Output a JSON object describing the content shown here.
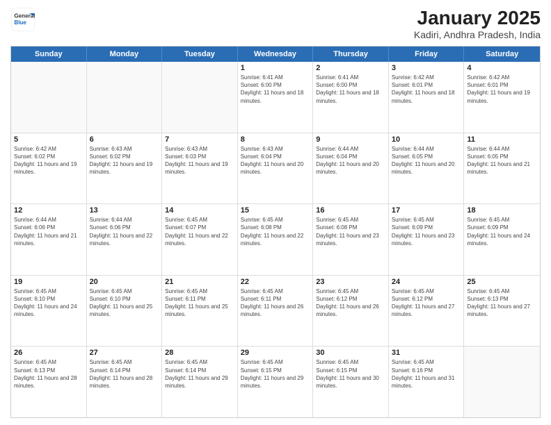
{
  "header": {
    "title": "January 2025",
    "subtitle": "Kadiri, Andhra Pradesh, India",
    "logo_general": "General",
    "logo_blue": "Blue"
  },
  "days_of_week": [
    "Sunday",
    "Monday",
    "Tuesday",
    "Wednesday",
    "Thursday",
    "Friday",
    "Saturday"
  ],
  "weeks": [
    [
      {
        "day": "",
        "empty": true
      },
      {
        "day": "",
        "empty": true
      },
      {
        "day": "",
        "empty": true
      },
      {
        "day": "1",
        "sunrise": "6:41 AM",
        "sunset": "6:00 PM",
        "daylight": "11 hours and 18 minutes."
      },
      {
        "day": "2",
        "sunrise": "6:41 AM",
        "sunset": "6:00 PM",
        "daylight": "11 hours and 18 minutes."
      },
      {
        "day": "3",
        "sunrise": "6:42 AM",
        "sunset": "6:01 PM",
        "daylight": "11 hours and 18 minutes."
      },
      {
        "day": "4",
        "sunrise": "6:42 AM",
        "sunset": "6:01 PM",
        "daylight": "11 hours and 19 minutes."
      }
    ],
    [
      {
        "day": "5",
        "sunrise": "6:42 AM",
        "sunset": "6:02 PM",
        "daylight": "11 hours and 19 minutes."
      },
      {
        "day": "6",
        "sunrise": "6:43 AM",
        "sunset": "6:02 PM",
        "daylight": "11 hours and 19 minutes."
      },
      {
        "day": "7",
        "sunrise": "6:43 AM",
        "sunset": "6:03 PM",
        "daylight": "11 hours and 19 minutes."
      },
      {
        "day": "8",
        "sunrise": "6:43 AM",
        "sunset": "6:04 PM",
        "daylight": "11 hours and 20 minutes."
      },
      {
        "day": "9",
        "sunrise": "6:44 AM",
        "sunset": "6:04 PM",
        "daylight": "11 hours and 20 minutes."
      },
      {
        "day": "10",
        "sunrise": "6:44 AM",
        "sunset": "6:05 PM",
        "daylight": "11 hours and 20 minutes."
      },
      {
        "day": "11",
        "sunrise": "6:44 AM",
        "sunset": "6:05 PM",
        "daylight": "11 hours and 21 minutes."
      }
    ],
    [
      {
        "day": "12",
        "sunrise": "6:44 AM",
        "sunset": "6:06 PM",
        "daylight": "11 hours and 21 minutes."
      },
      {
        "day": "13",
        "sunrise": "6:44 AM",
        "sunset": "6:06 PM",
        "daylight": "11 hours and 22 minutes."
      },
      {
        "day": "14",
        "sunrise": "6:45 AM",
        "sunset": "6:07 PM",
        "daylight": "11 hours and 22 minutes."
      },
      {
        "day": "15",
        "sunrise": "6:45 AM",
        "sunset": "6:08 PM",
        "daylight": "11 hours and 22 minutes."
      },
      {
        "day": "16",
        "sunrise": "6:45 AM",
        "sunset": "6:08 PM",
        "daylight": "11 hours and 23 minutes."
      },
      {
        "day": "17",
        "sunrise": "6:45 AM",
        "sunset": "6:09 PM",
        "daylight": "11 hours and 23 minutes."
      },
      {
        "day": "18",
        "sunrise": "6:45 AM",
        "sunset": "6:09 PM",
        "daylight": "11 hours and 24 minutes."
      }
    ],
    [
      {
        "day": "19",
        "sunrise": "6:45 AM",
        "sunset": "6:10 PM",
        "daylight": "11 hours and 24 minutes."
      },
      {
        "day": "20",
        "sunrise": "6:45 AM",
        "sunset": "6:10 PM",
        "daylight": "11 hours and 25 minutes."
      },
      {
        "day": "21",
        "sunrise": "6:45 AM",
        "sunset": "6:11 PM",
        "daylight": "11 hours and 25 minutes."
      },
      {
        "day": "22",
        "sunrise": "6:45 AM",
        "sunset": "6:11 PM",
        "daylight": "11 hours and 26 minutes."
      },
      {
        "day": "23",
        "sunrise": "6:45 AM",
        "sunset": "6:12 PM",
        "daylight": "11 hours and 26 minutes."
      },
      {
        "day": "24",
        "sunrise": "6:45 AM",
        "sunset": "6:12 PM",
        "daylight": "11 hours and 27 minutes."
      },
      {
        "day": "25",
        "sunrise": "6:45 AM",
        "sunset": "6:13 PM",
        "daylight": "11 hours and 27 minutes."
      }
    ],
    [
      {
        "day": "26",
        "sunrise": "6:45 AM",
        "sunset": "6:13 PM",
        "daylight": "11 hours and 28 minutes."
      },
      {
        "day": "27",
        "sunrise": "6:45 AM",
        "sunset": "6:14 PM",
        "daylight": "11 hours and 28 minutes."
      },
      {
        "day": "28",
        "sunrise": "6:45 AM",
        "sunset": "6:14 PM",
        "daylight": "11 hours and 29 minutes."
      },
      {
        "day": "29",
        "sunrise": "6:45 AM",
        "sunset": "6:15 PM",
        "daylight": "11 hours and 29 minutes."
      },
      {
        "day": "30",
        "sunrise": "6:45 AM",
        "sunset": "6:15 PM",
        "daylight": "11 hours and 30 minutes."
      },
      {
        "day": "31",
        "sunrise": "6:45 AM",
        "sunset": "6:16 PM",
        "daylight": "11 hours and 31 minutes."
      },
      {
        "day": "",
        "empty": true
      }
    ]
  ]
}
